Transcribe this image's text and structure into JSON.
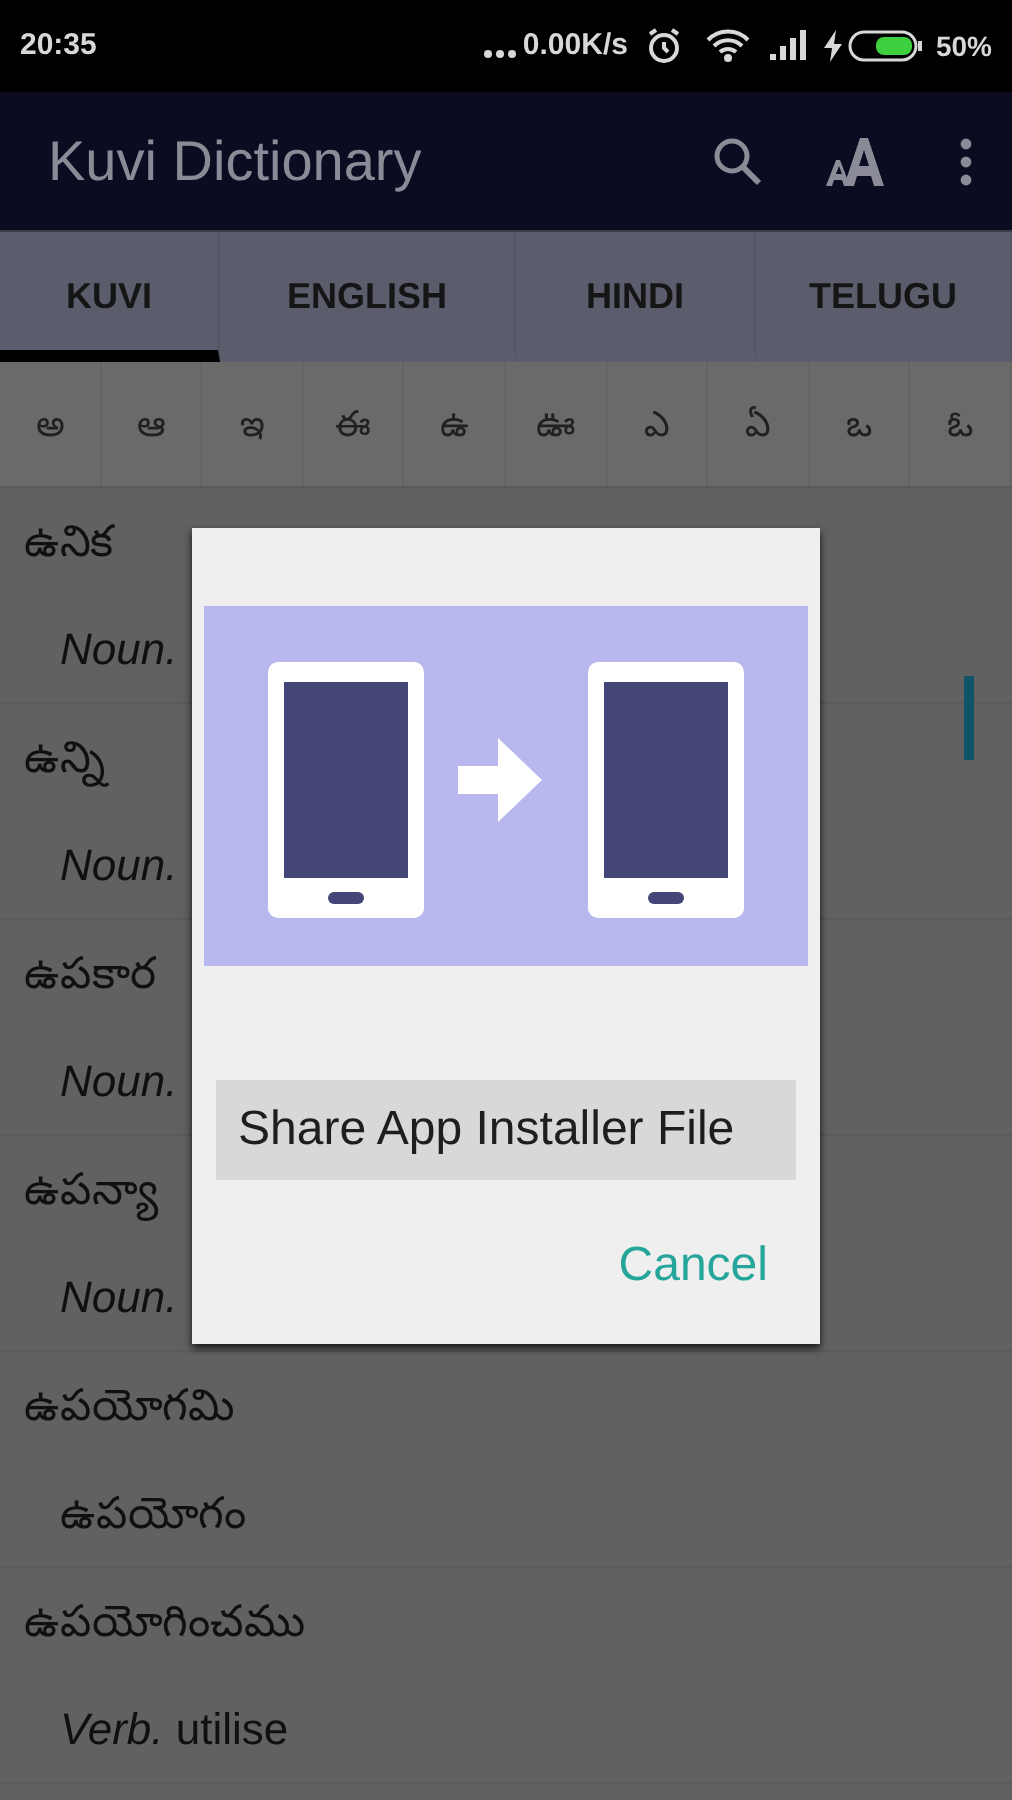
{
  "status_bar": {
    "time": "20:35",
    "speed": "0.00K/s",
    "battery": "50%"
  },
  "app_bar": {
    "title": "Kuvi Dictionary"
  },
  "tabs": [
    {
      "label": "KUVI",
      "selected": true
    },
    {
      "label": "ENGLISH",
      "selected": false
    },
    {
      "label": "HINDI",
      "selected": false
    },
    {
      "label": "TELUGU",
      "selected": false
    }
  ],
  "letters": [
    "అ",
    "ఆ",
    "ఇ",
    "ఈ",
    "ఉ",
    "ఊ",
    "ఎ",
    "ఏ",
    "ఒ",
    "ఓ"
  ],
  "entries": [
    {
      "word": "ఉనిక",
      "meaning": "*Noun.*"
    },
    {
      "word": "ఉన్ని",
      "meaning": "*Noun.*"
    },
    {
      "word": "ఉపకార",
      "meaning": "*Noun.*"
    },
    {
      "word": "ఉపన్యా",
      "meaning": "*Noun.*"
    },
    {
      "word": "ఉపయోగమి",
      "meaning": "ఉపయోగం"
    },
    {
      "word": "ఉపయోగించము",
      "meaning": "*Verb.* utilise"
    }
  ],
  "dialog": {
    "option": "Share App Installer File",
    "cancel": "Cancel"
  }
}
